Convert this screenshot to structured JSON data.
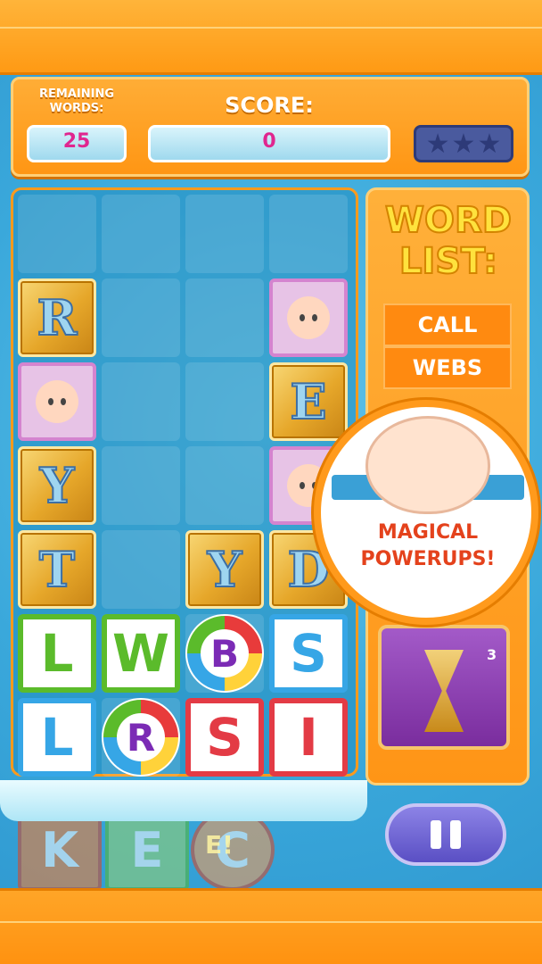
{
  "header": {
    "remaining_label": "REMAINING\nWORDS:",
    "remaining_value": "25",
    "score_label": "SCORE:",
    "score_value": "0",
    "stars": [
      "★",
      "★",
      "★"
    ]
  },
  "word_list": {
    "title_line1": "WORD",
    "title_line2": "LIST:",
    "words": [
      "CALL",
      "WEBS"
    ]
  },
  "powerup_popup": {
    "line1": "MAGICAL",
    "line2": "POWERUPS!"
  },
  "hourglass": {
    "count": "3"
  },
  "board": {
    "tiles": [
      {
        "letter": "R",
        "style": "gold",
        "col": 0,
        "row": 1
      },
      {
        "letter": "",
        "style": "baby",
        "col": 3,
        "row": 1
      },
      {
        "letter": "",
        "style": "baby",
        "col": 0,
        "row": 2
      },
      {
        "letter": "E",
        "style": "gold",
        "col": 3,
        "row": 2
      },
      {
        "letter": "Y",
        "style": "gold",
        "col": 0,
        "row": 3
      },
      {
        "letter": "",
        "style": "baby",
        "col": 3,
        "row": 3
      },
      {
        "letter": "T",
        "style": "gold",
        "col": 0,
        "row": 4
      },
      {
        "letter": "Y",
        "style": "gold",
        "col": 2,
        "row": 4
      },
      {
        "letter": "D",
        "style": "gold",
        "col": 3,
        "row": 4
      },
      {
        "letter": "L",
        "style": "green",
        "col": 0,
        "row": 5
      },
      {
        "letter": "W",
        "style": "green",
        "col": 1,
        "row": 5
      },
      {
        "letter": "B",
        "style": "ball",
        "col": 2,
        "row": 5
      },
      {
        "letter": "S",
        "style": "blue",
        "col": 3,
        "row": 5
      },
      {
        "letter": "L",
        "style": "blue",
        "col": 0,
        "row": 6
      },
      {
        "letter": "R",
        "style": "ball",
        "col": 1,
        "row": 6
      },
      {
        "letter": "S",
        "style": "red",
        "col": 2,
        "row": 6
      },
      {
        "letter": "I",
        "style": "red",
        "col": 3,
        "row": 6
      }
    ]
  },
  "bottom": {
    "tiles": [
      "K",
      "E",
      "C"
    ],
    "hint": "E!"
  },
  "colors": {
    "orange": "#ff9a1c",
    "score_pink": "#e0268f",
    "star_navy": "#2d3a78"
  }
}
